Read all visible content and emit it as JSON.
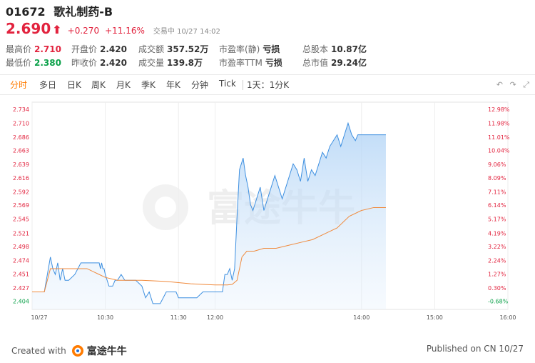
{
  "stock": {
    "code": "01672",
    "name": "歌礼制药-B",
    "price": "2.690",
    "change": "+0.270",
    "change_pct": "+11.16%",
    "status": "交易中 10/27 14:02"
  },
  "stats": {
    "row1": [
      {
        "label": "最高价",
        "value": "2.710",
        "tone": "red"
      },
      {
        "label": "开盘价",
        "value": "2.420",
        "tone": "plain"
      },
      {
        "label": "成交额",
        "value": "357.52万",
        "tone": "plain"
      },
      {
        "label": "市盈率(静)",
        "value": "亏损",
        "tone": "plain"
      },
      {
        "label": "总股本",
        "value": "10.87亿",
        "tone": "plain"
      }
    ],
    "row2": [
      {
        "label": "最低价",
        "value": "2.380",
        "tone": "green"
      },
      {
        "label": "昨收价",
        "value": "2.420",
        "tone": "plain"
      },
      {
        "label": "成交量",
        "value": "139.8万",
        "tone": "plain"
      },
      {
        "label": "市盈率TTM",
        "value": "亏损",
        "tone": "plain"
      },
      {
        "label": "总市值",
        "value": "29.24亿",
        "tone": "plain"
      }
    ]
  },
  "tabs": [
    "分时",
    "多日",
    "日K",
    "周K",
    "月K",
    "季K",
    "年K",
    "分钟",
    "Tick"
  ],
  "active_tab": "分时",
  "period_selector": "1天：1分K",
  "toolbar_icons": [
    "undo-icon",
    "redo-icon",
    "fullscreen-icon"
  ],
  "watermark": "富途牛牛",
  "footer": {
    "created_with": "Created with",
    "brand": "富途牛牛",
    "published": "Published on CN 10/27"
  },
  "colors": {
    "up": "#e2233e",
    "down": "#0ca14a",
    "price_line": "#3d8fe0",
    "avg_line": "#f08a3c",
    "active_tab": "#ff7b00"
  },
  "chart_data": {
    "type": "line",
    "x_ticks": [
      "10/27",
      "10:30",
      "11:30",
      "12:00",
      "14:00",
      "15:00",
      "16:00"
    ],
    "y_ticks_left": [
      "2.734",
      "2.710",
      "2.686",
      "2.663",
      "2.639",
      "2.616",
      "2.592",
      "2.569",
      "2.545",
      "2.521",
      "2.498",
      "2.474",
      "2.451",
      "2.427",
      "2.404"
    ],
    "y_ticks_right": [
      "12.98%",
      "11.98%",
      "11.01%",
      "10.04%",
      "9.06%",
      "8.09%",
      "7.11%",
      "6.14%",
      "5.17%",
      "4.19%",
      "3.22%",
      "2.24%",
      "1.27%",
      "0.30%",
      "-0.68%"
    ],
    "ylim": [
      2.39,
      2.746
    ],
    "prev_close": 2.42,
    "series": [
      {
        "name": "",
        "kind": "price",
        "x": [
          "09:30",
          "09:40",
          "09:45",
          "09:47",
          "09:49",
          "09:51",
          "09:53",
          "09:55",
          "09:57",
          "10:00",
          "10:05",
          "10:10",
          "10:15",
          "10:20",
          "10:25",
          "10:26",
          "10:27",
          "10:28",
          "10:29",
          "10:30",
          "10:33",
          "10:36",
          "10:38",
          "10:40",
          "10:43",
          "10:46",
          "10:50",
          "10:55",
          "11:00",
          "11:03",
          "11:06",
          "11:09",
          "11:12",
          "11:15",
          "11:20",
          "11:25",
          "11:28",
          "11:30",
          "11:35",
          "11:40",
          "11:45",
          "11:50",
          "11:55",
          "12:00",
          "12:02",
          "12:04",
          "12:06",
          "12:08",
          "12:10",
          "12:12",
          "12:14",
          "12:16",
          "12:18",
          "12:20",
          "12:23",
          "12:25",
          "12:27",
          "12:29",
          "12:31",
          "12:34",
          "12:37",
          "12:40",
          "12:43",
          "12:46",
          "12:49",
          "12:52",
          "12:55",
          "12:58",
          "13:01",
          "13:04",
          "13:07",
          "13:10",
          "13:13",
          "13:16",
          "13:19",
          "13:22",
          "13:25",
          "13:28",
          "13:31",
          "13:34",
          "13:37",
          "13:40",
          "13:43",
          "13:46",
          "13:49",
          "13:52",
          "13:55",
          "13:57",
          "13:59",
          "14:00",
          "14:01",
          "14:02",
          "14:05",
          "14:10",
          "14:15",
          "14:20"
        ],
        "values": [
          2.42,
          2.42,
          2.48,
          2.46,
          2.45,
          2.47,
          2.44,
          2.46,
          2.44,
          2.44,
          2.45,
          2.47,
          2.47,
          2.47,
          2.47,
          2.46,
          2.47,
          2.46,
          2.46,
          2.45,
          2.43,
          2.43,
          2.44,
          2.44,
          2.45,
          2.44,
          2.44,
          2.44,
          2.43,
          2.41,
          2.42,
          2.4,
          2.4,
          2.4,
          2.42,
          2.42,
          2.42,
          2.41,
          2.41,
          2.41,
          2.41,
          2.42,
          2.42,
          2.42,
          2.42,
          2.42,
          2.42,
          2.45,
          2.45,
          2.46,
          2.44,
          2.46,
          2.55,
          2.63,
          2.65,
          2.62,
          2.6,
          2.57,
          2.56,
          2.58,
          2.6,
          2.56,
          2.58,
          2.6,
          2.62,
          2.6,
          2.58,
          2.6,
          2.62,
          2.64,
          2.63,
          2.61,
          2.65,
          2.61,
          2.63,
          2.62,
          2.64,
          2.66,
          2.65,
          2.67,
          2.68,
          2.69,
          2.67,
          2.69,
          2.71,
          2.69,
          2.68,
          2.69,
          2.69,
          2.69,
          2.69,
          2.69,
          2.69,
          2.69,
          2.69,
          2.69
        ]
      },
      {
        "name": "",
        "kind": "average",
        "x": [
          "09:30",
          "09:40",
          "09:45",
          "10:00",
          "10:15",
          "10:25",
          "10:30",
          "10:40",
          "11:00",
          "11:20",
          "11:30",
          "11:40",
          "11:50",
          "12:00",
          "12:06",
          "12:10",
          "12:14",
          "12:18",
          "12:22",
          "12:26",
          "12:32",
          "12:40",
          "12:50",
          "13:00",
          "13:10",
          "13:20",
          "13:30",
          "13:40",
          "13:50",
          "14:00",
          "14:10",
          "14:20"
        ],
        "values": [
          2.42,
          2.42,
          2.46,
          2.46,
          2.46,
          2.45,
          2.445,
          2.44,
          2.44,
          2.438,
          2.436,
          2.434,
          2.433,
          2.432,
          2.432,
          2.432,
          2.433,
          2.44,
          2.48,
          2.49,
          2.49,
          2.495,
          2.495,
          2.5,
          2.505,
          2.51,
          2.52,
          2.53,
          2.55,
          2.56,
          2.565,
          2.565
        ]
      }
    ]
  }
}
